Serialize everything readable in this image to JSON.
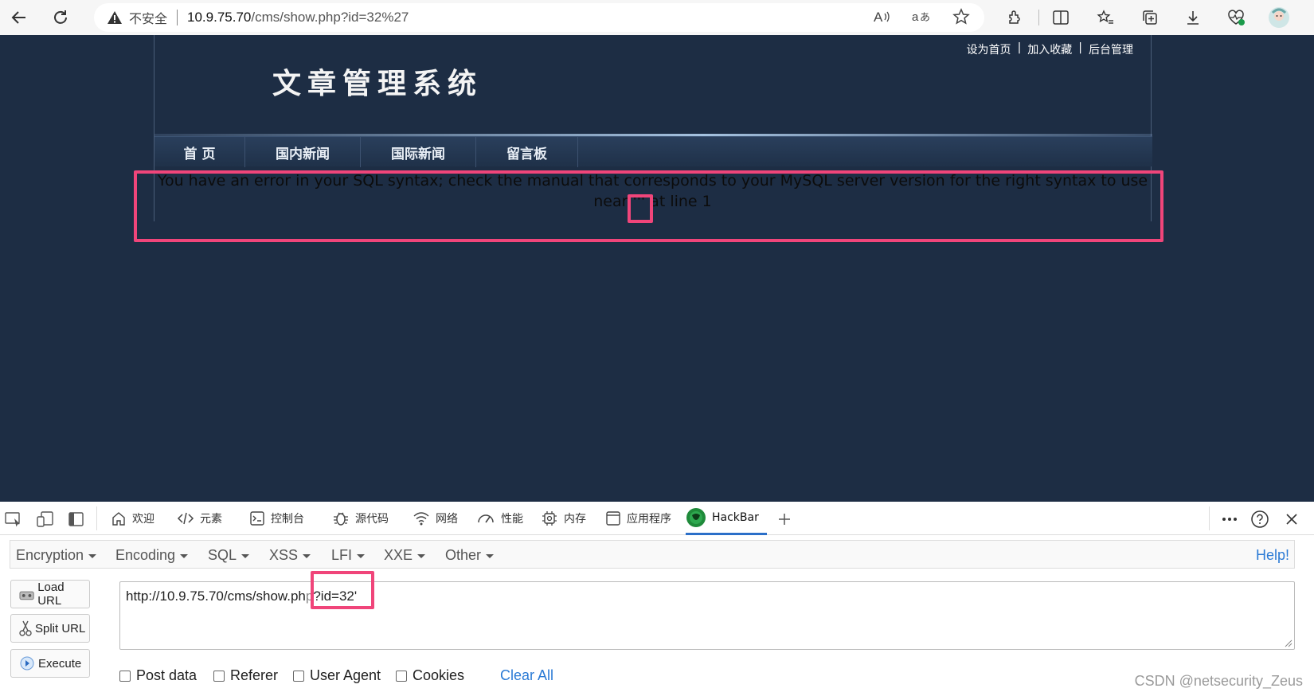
{
  "browser": {
    "insecure_label": "不安全",
    "url_host": "10.9.75.70",
    "url_rest": "/cms/show.php?id=32%27"
  },
  "site": {
    "top_links": [
      "设为首页",
      "加入收藏",
      "后台管理"
    ],
    "top_link_separator": "|",
    "title": "文章管理系统",
    "menu": [
      "首 页",
      "国内新闻",
      "国际新闻",
      "留言板"
    ],
    "error_line1": "You have an error in your SQL syntax; check the manual that corresponds to your MySQL server version for the right syntax to use",
    "error_line2": "near ''' at line 1"
  },
  "devtools": {
    "tabs": [
      {
        "label": "欢迎",
        "icon": "home-icon"
      },
      {
        "label": "元素",
        "icon": "code-icon"
      },
      {
        "label": "控制台",
        "icon": "console-icon"
      },
      {
        "label": "源代码",
        "icon": "bug-icon"
      },
      {
        "label": "网络",
        "icon": "wifi-icon"
      },
      {
        "label": "性能",
        "icon": "gauge-icon"
      },
      {
        "label": "内存",
        "icon": "chip-icon"
      },
      {
        "label": "应用程序",
        "icon": "window-icon"
      },
      {
        "label": "HackBar",
        "icon": "hackbar-icon",
        "active": true
      }
    ]
  },
  "hackbar": {
    "menu": [
      "Encryption",
      "Encoding",
      "SQL",
      "XSS",
      "LFI",
      "XXE",
      "Other"
    ],
    "help": "Help!",
    "buttons": [
      "Load URL",
      "Split URL",
      "Execute"
    ],
    "url_prefix": "http://10.9.75.70/cms/show.ph",
    "url_cut": "p",
    "url_suffix": "?id=32'",
    "checkboxes": [
      "Post data",
      "Referer",
      "User Agent",
      "Cookies"
    ],
    "clear_all": "Clear All"
  },
  "watermark": "CSDN @netsecurity_Zeus",
  "colors": {
    "page_bg": "#1d2d44",
    "highlight": "#f0457a",
    "link_blue": "#2a7ad5",
    "active_tab": "#2b6fc8"
  }
}
